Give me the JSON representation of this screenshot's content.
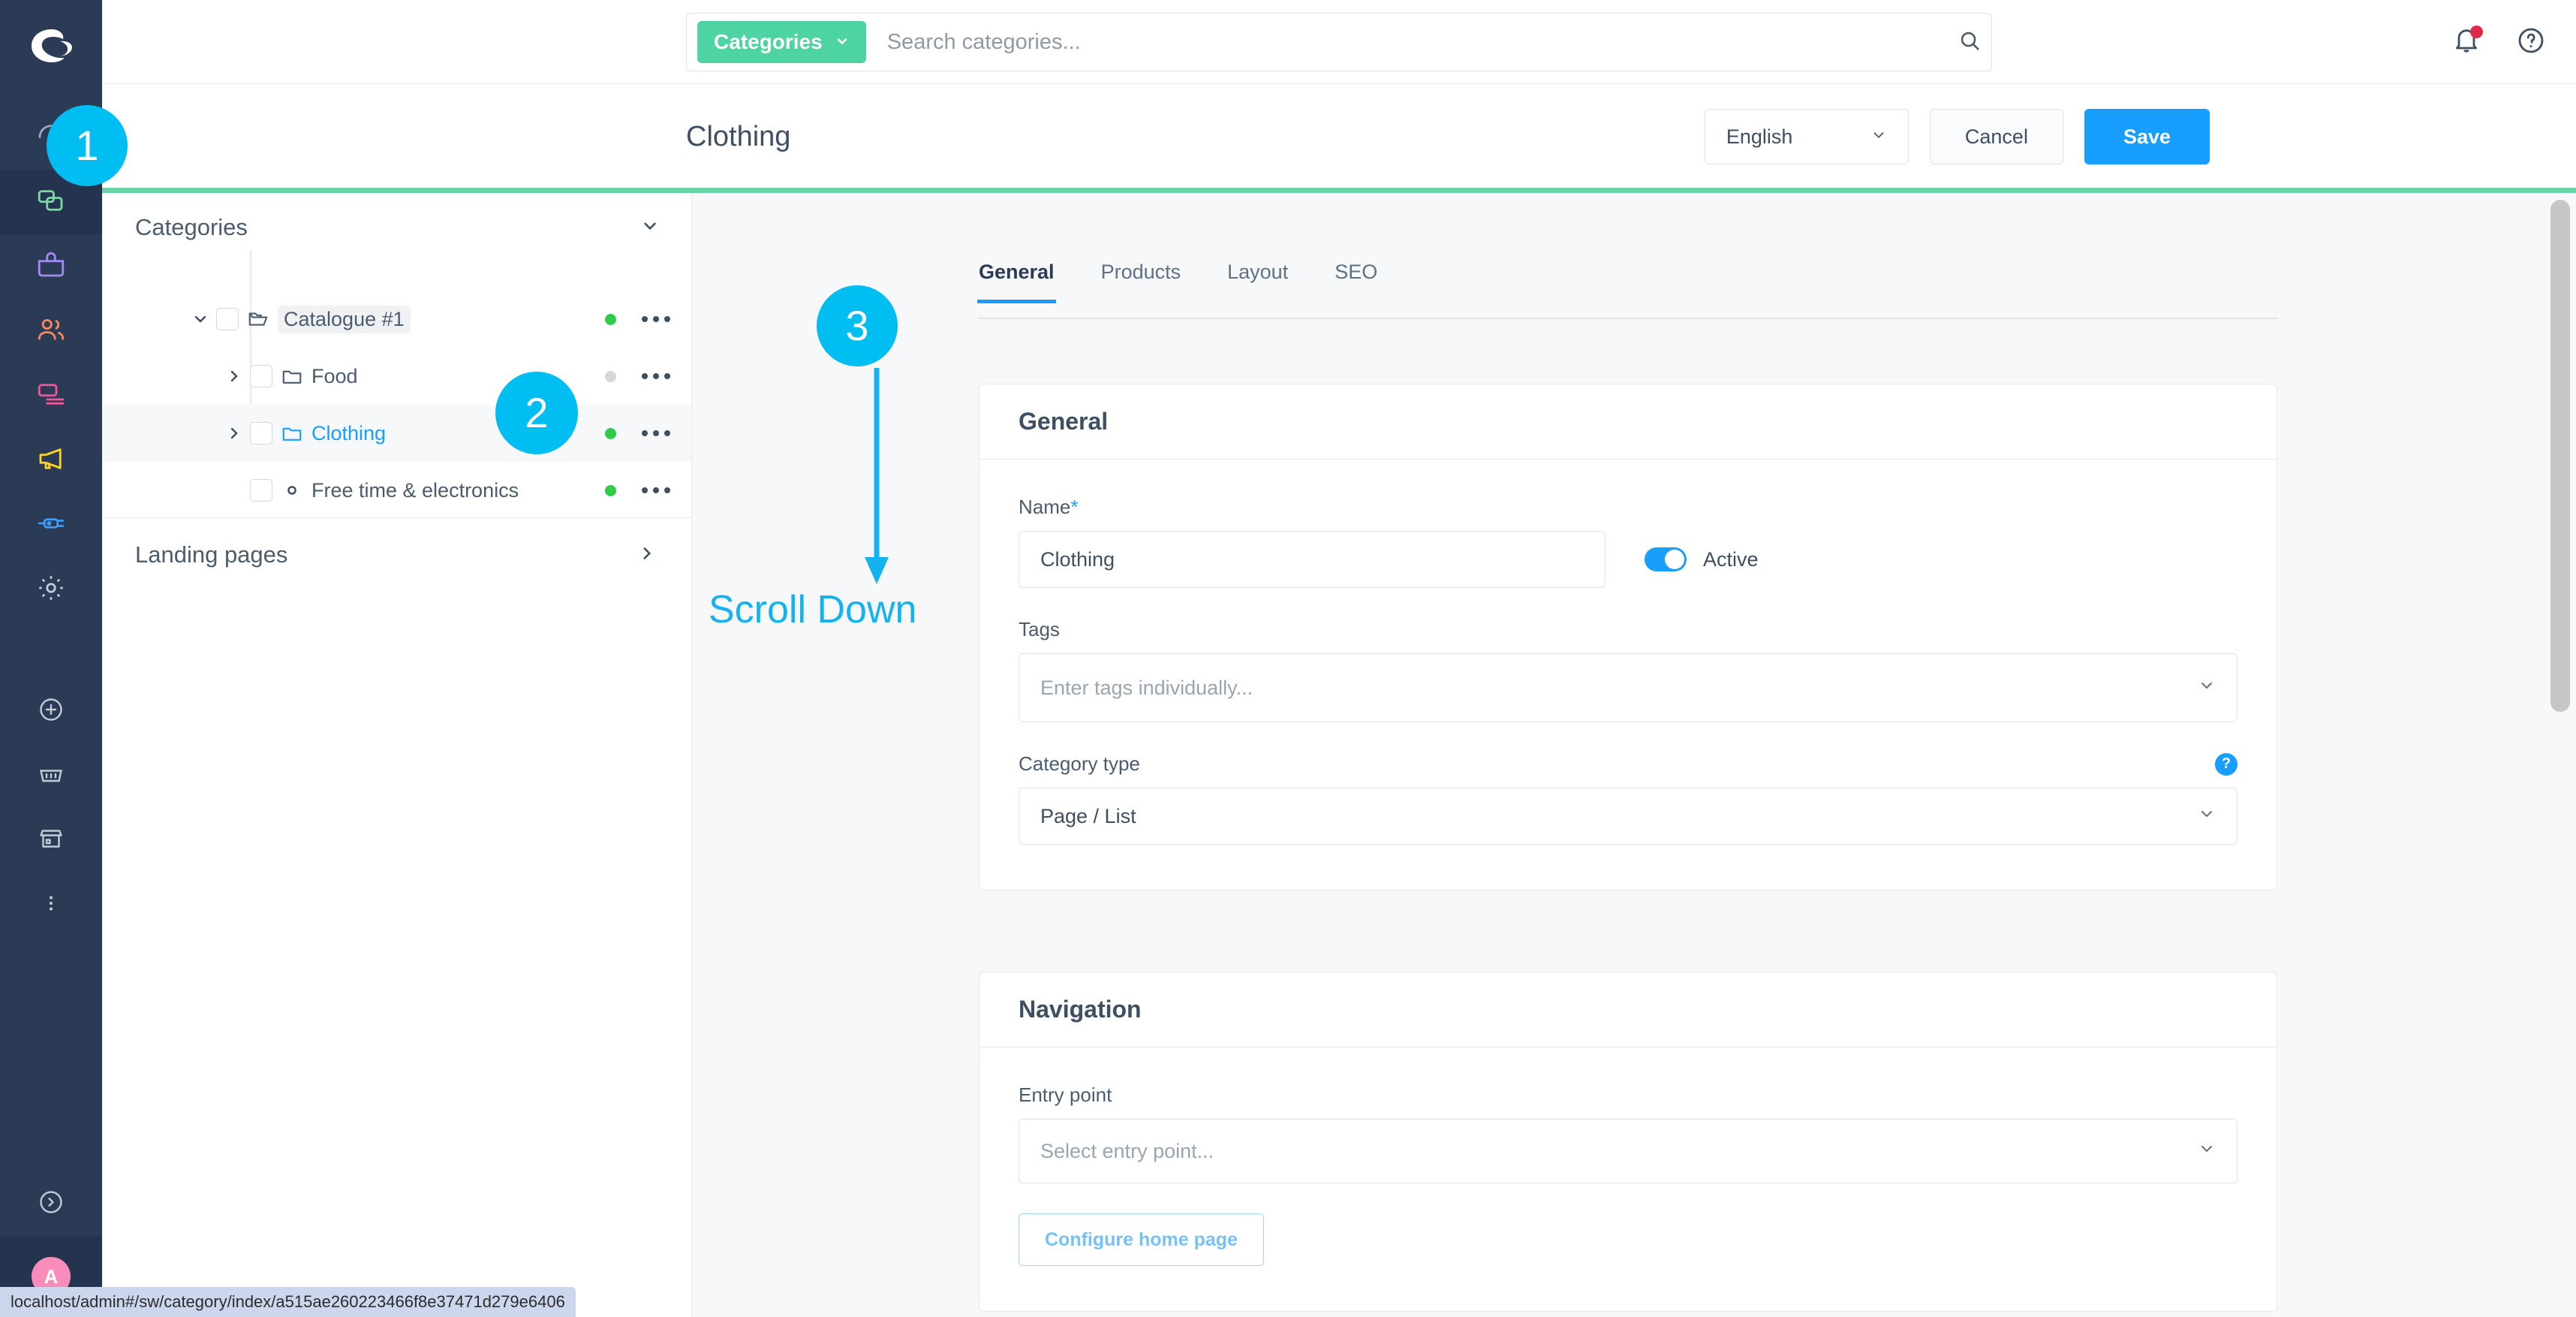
{
  "sidebar": {
    "logo_name": "shopware-logo",
    "items": [
      {
        "name": "dashboard",
        "icon": "gauge-icon",
        "color": "#9fb0c9",
        "active": false
      },
      {
        "name": "catalogues",
        "icon": "catalogues-icon",
        "color": "#7ed9a5",
        "active": true
      },
      {
        "name": "orders",
        "icon": "bag-icon",
        "color": "#a58af5",
        "active": false
      },
      {
        "name": "customers",
        "icon": "users-icon",
        "color": "#f78b5c",
        "active": false
      },
      {
        "name": "content",
        "icon": "content-icon",
        "color": "#f2559a",
        "active": false
      },
      {
        "name": "marketing",
        "icon": "megaphone-icon",
        "color": "#ffd426",
        "active": false
      },
      {
        "name": "extensions",
        "icon": "plug-icon",
        "color": "#3e9dfb",
        "active": false
      },
      {
        "name": "settings",
        "icon": "gear-icon",
        "color": "#c3ccd6",
        "active": false
      }
    ],
    "lower_items": [
      {
        "name": "add",
        "icon": "plus-circle-icon"
      },
      {
        "name": "basket",
        "icon": "basket-icon"
      },
      {
        "name": "storefront",
        "icon": "store-icon"
      },
      {
        "name": "more",
        "icon": "more-vertical-icon"
      }
    ],
    "collapse": {
      "name": "collapse-sidebar",
      "icon": "chevron-right-circle-icon"
    },
    "avatar_initial": "A"
  },
  "topbar": {
    "search_scope_label": "Categories",
    "search_scope_icon": "chevron-down-icon",
    "search_placeholder": "Search categories...",
    "search_value": "",
    "search_icon": "search-icon",
    "notification_icon": "bell-icon",
    "notification_badge_color": "#e0294a",
    "help_icon": "help-circle-icon"
  },
  "header": {
    "title": "Clothing",
    "language": "English",
    "language_caret": "chevron-down-icon",
    "cancel_label": "Cancel",
    "save_label": "Save",
    "accent_color": "#6ad3a8"
  },
  "tree_panel": {
    "header_title": "Categories",
    "header_caret": "chevron-down-icon",
    "nodes": [
      {
        "label": "Catalogue #1",
        "level": 0,
        "caret": "chevron-down-icon",
        "icon": "folder-open-icon",
        "status": "green",
        "selected": false,
        "highlighted": true,
        "active_text": false,
        "kebab": "more-horizontal-icon"
      },
      {
        "label": "Food",
        "level": 1,
        "caret": "chevron-right-icon",
        "icon": "folder-icon",
        "status": "gray",
        "selected": false,
        "highlighted": false,
        "active_text": false,
        "kebab": "more-horizontal-icon"
      },
      {
        "label": "Clothing",
        "level": 1,
        "caret": "chevron-right-icon",
        "icon": "folder-icon",
        "status": "green",
        "selected": true,
        "highlighted": false,
        "active_text": true,
        "kebab": "more-horizontal-icon"
      },
      {
        "label": "Free time & electronics",
        "level": 1,
        "caret": "",
        "icon": "circle-dot-icon",
        "status": "green",
        "selected": false,
        "highlighted": false,
        "active_text": false,
        "kebab": "more-horizontal-icon"
      }
    ],
    "landing_pages_label": "Landing pages",
    "landing_pages_caret": "chevron-right-icon"
  },
  "main": {
    "tabs": [
      {
        "label": "General",
        "active": true
      },
      {
        "label": "Products",
        "active": false
      },
      {
        "label": "Layout",
        "active": false
      },
      {
        "label": "SEO",
        "active": false
      }
    ],
    "general_card": {
      "title": "General",
      "name_label": "Name",
      "name_required_marker": "*",
      "name_value": "Clothing",
      "active_toggle_label": "Active",
      "active_toggle_on": true,
      "tags_label": "Tags",
      "tags_placeholder": "Enter tags individually...",
      "tags_caret": "chevron-down-icon",
      "category_type_label": "Category type",
      "category_type_help_icon": "help-circle-icon",
      "category_type_value": "Page / List",
      "category_type_caret": "chevron-down-icon"
    },
    "navigation_card": {
      "title": "Navigation",
      "entry_point_label": "Entry point",
      "entry_point_placeholder": "Select entry point...",
      "entry_point_caret": "chevron-down-icon",
      "configure_home_page_label": "Configure home page"
    }
  },
  "annotations": {
    "marker_color": "#00bdf2",
    "items": [
      {
        "id": "1",
        "label": "1"
      },
      {
        "id": "2",
        "label": "2"
      },
      {
        "id": "3",
        "label": "3"
      }
    ],
    "scroll_down_text": "Scroll Down"
  },
  "status_bar": {
    "url": "localhost/admin#/sw/category/index/a515ae260223466f8e37471d279e6406"
  }
}
